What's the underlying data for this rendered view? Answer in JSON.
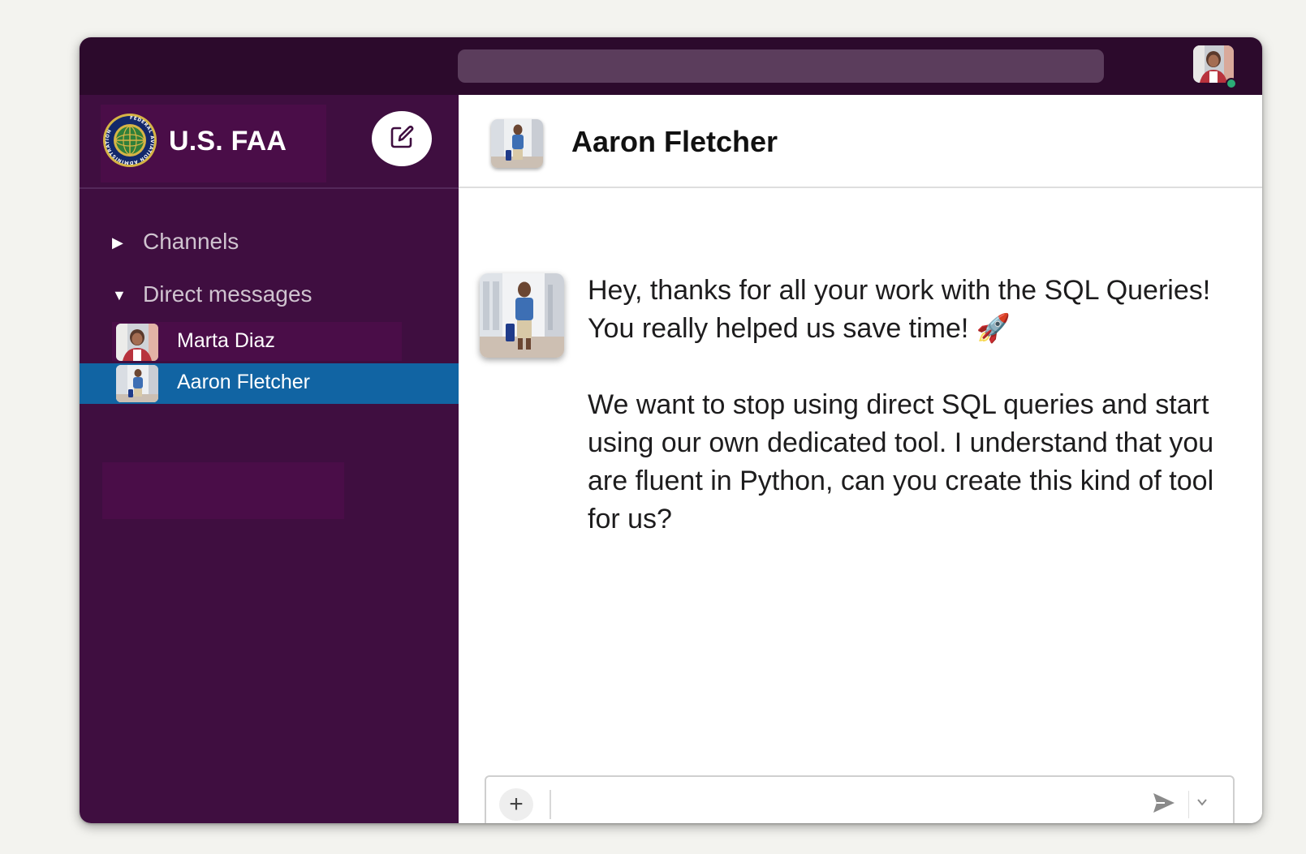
{
  "workspace": {
    "name": "U.S. FAA",
    "logo": "faa-seal",
    "logo_ring_text": "FEDERAL AVIATION ADMINISTRATION"
  },
  "sidebar": {
    "sections": [
      {
        "label": "Channels",
        "expanded": false
      },
      {
        "label": "Direct messages",
        "expanded": true
      }
    ],
    "direct_messages": [
      {
        "name": "Marta Diaz",
        "active": false
      },
      {
        "name": "Aaron Fletcher",
        "active": true
      }
    ]
  },
  "chat": {
    "title": "Aaron Fletcher",
    "messages": [
      {
        "sender": "Aaron Fletcher",
        "paragraphs": [
          "Hey, thanks for all your work with the SQL Queries! You really helped us save time! 🚀",
          "We want to stop using direct SQL queries and start using our own dedicated tool. I understand that you are fluent in Python, can you create this kind of tool for us?"
        ]
      }
    ]
  },
  "composer": {
    "value": "",
    "add_icon": "plus-icon",
    "send_icon": "send-icon",
    "options_icon": "chevron-down-icon"
  },
  "colors": {
    "topbar": "#2c0a2c",
    "sidebar": "#3f0e40",
    "active_item": "#1164a3",
    "search": "#5b3d5c"
  }
}
